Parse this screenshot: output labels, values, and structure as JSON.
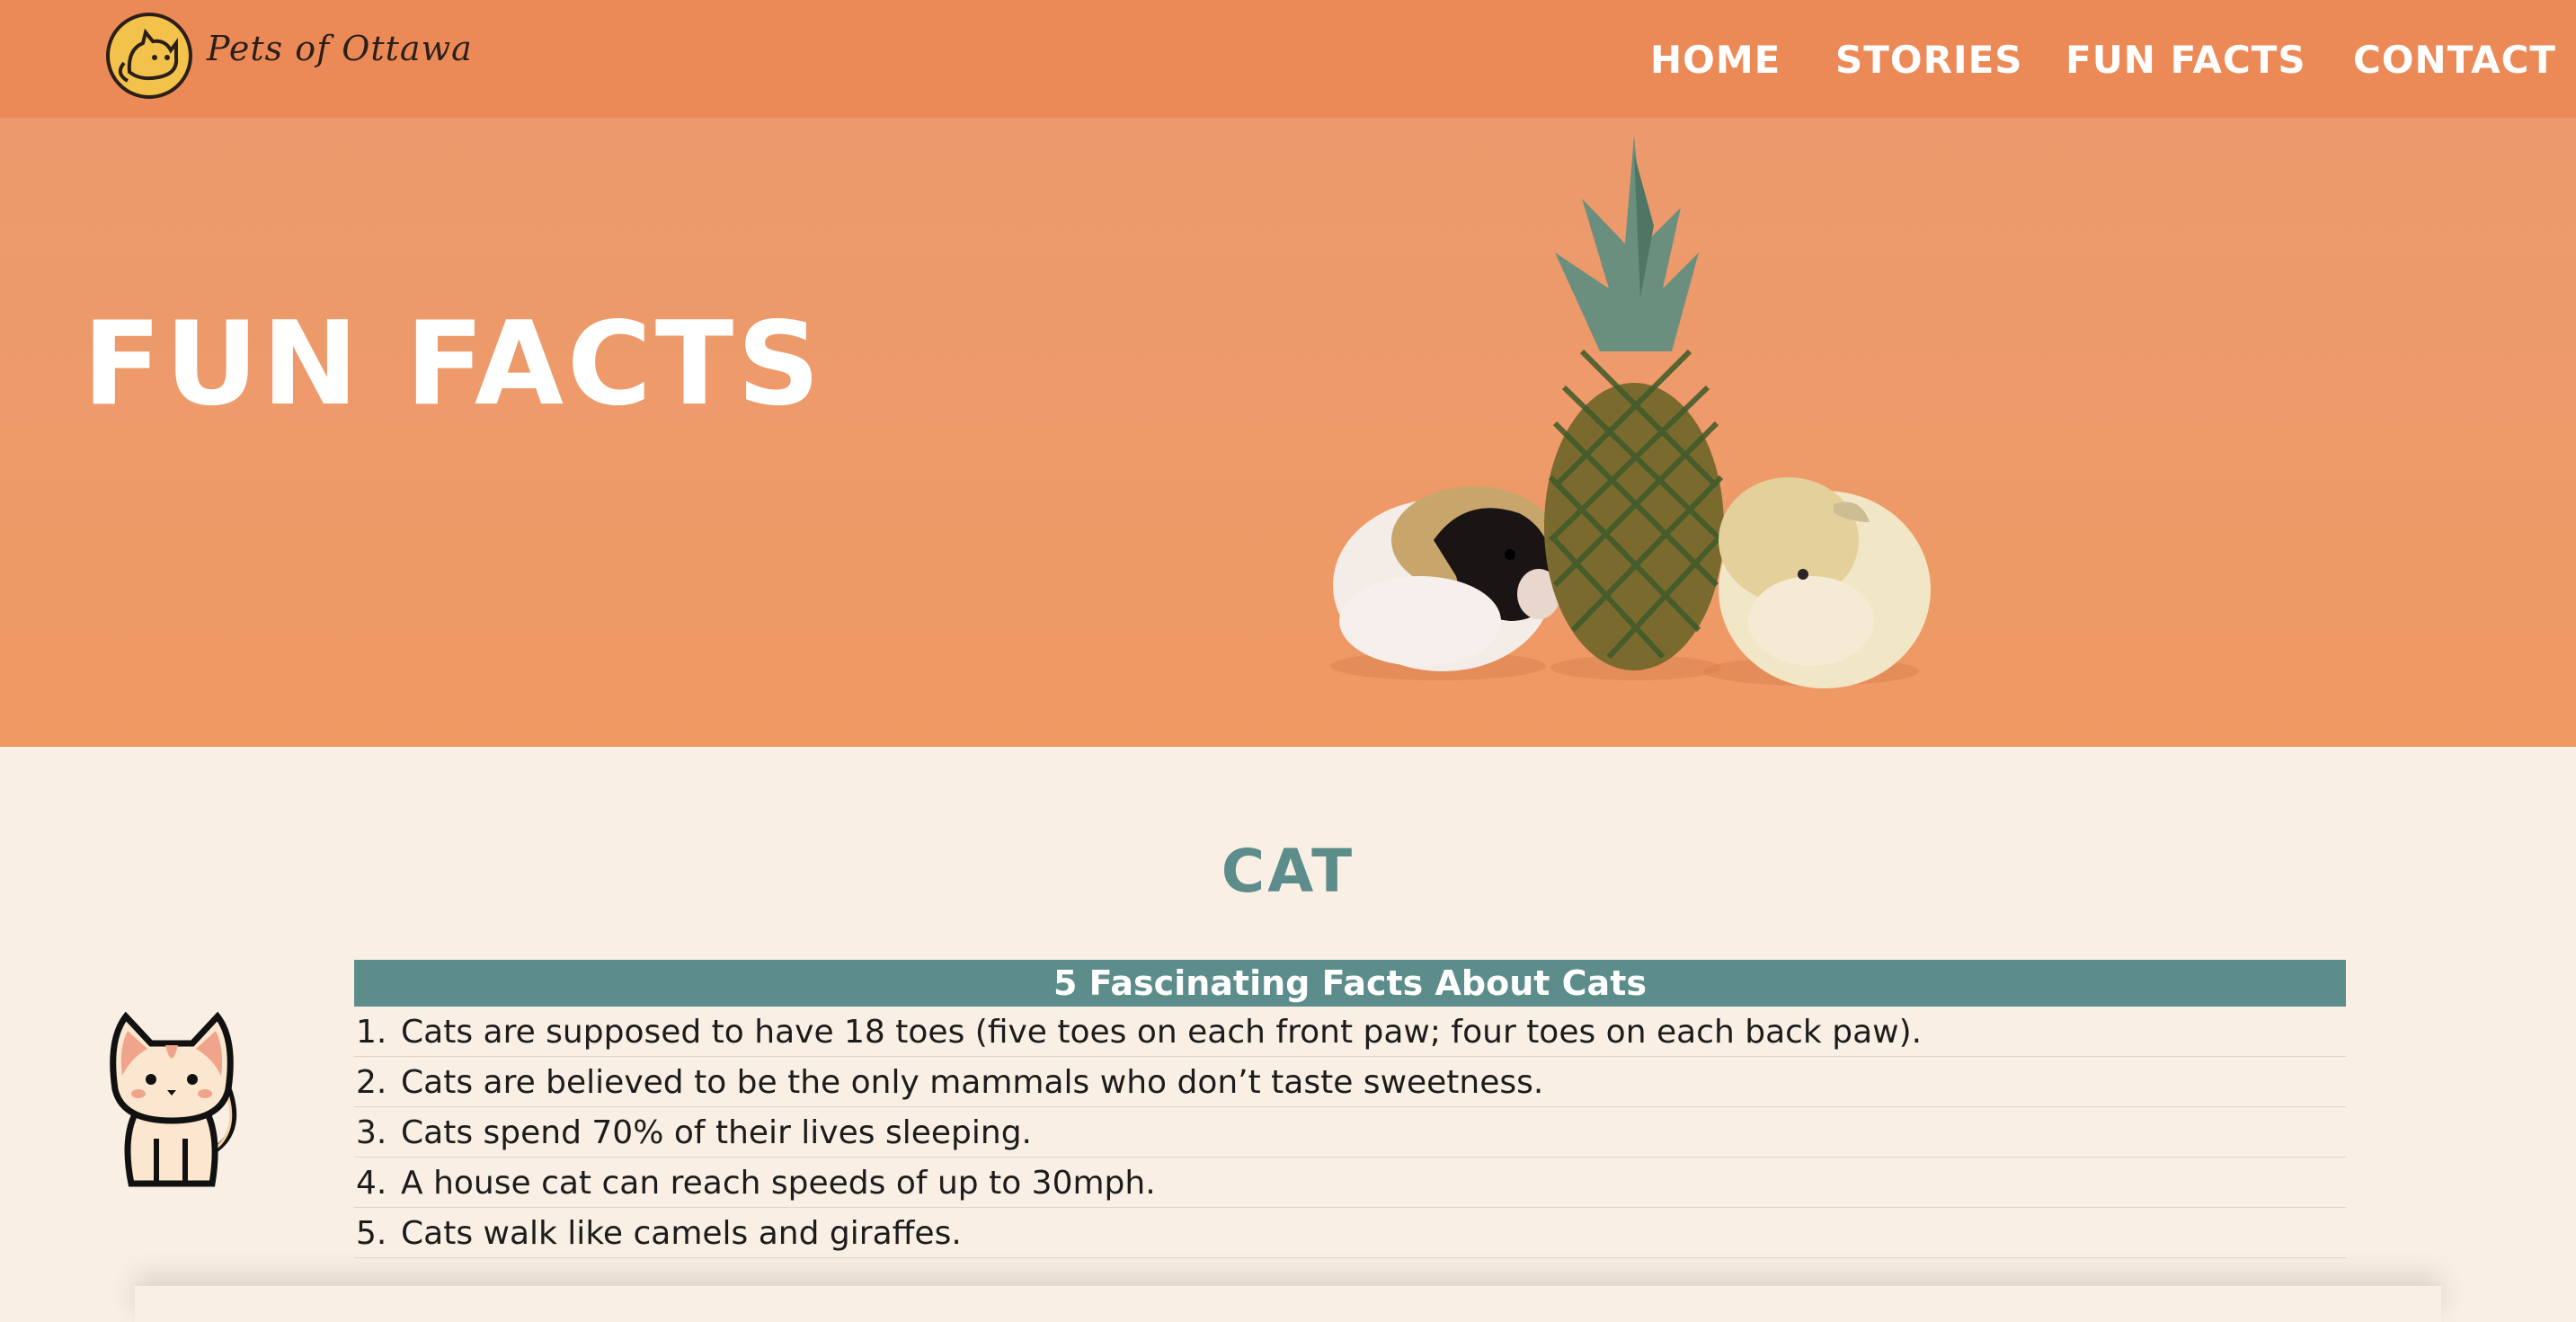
{
  "brand": {
    "name": "Pets of Ottawa",
    "logo_icon": "cat-logo-icon",
    "accent": "#ec8a57"
  },
  "nav": {
    "items": [
      {
        "label": "HOME"
      },
      {
        "label": "STORIES"
      },
      {
        "label": "FUN FACTS"
      },
      {
        "label": "CONTACT"
      }
    ]
  },
  "hero": {
    "title": "FUN FACTS",
    "image": "guinea-pigs-and-pineapple-photo"
  },
  "section": {
    "title": "CAT",
    "title_color": "#5c8d8b",
    "illustration": "cat-illustration-icon"
  },
  "facts_table": {
    "header": "5 Fascinating Facts About Cats",
    "rows": [
      {
        "num": "1.",
        "text": "Cats are supposed to have 18 toes (five toes on each front paw; four toes on each back paw)."
      },
      {
        "num": "2.",
        "text": "Cats are believed to be the only mammals who don’t taste sweetness."
      },
      {
        "num": "3.",
        "text": "Cats spend 70% of their lives sleeping."
      },
      {
        "num": "4.",
        "text": "A house cat can reach speeds of up to 30mph."
      },
      {
        "num": "5.",
        "text": "Cats walk like camels and giraffes."
      }
    ]
  }
}
